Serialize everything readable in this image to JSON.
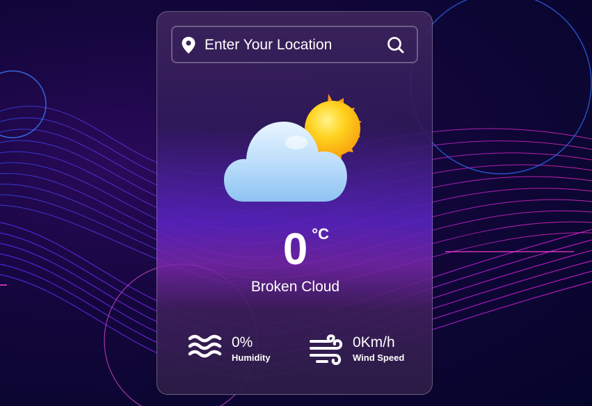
{
  "search": {
    "placeholder": "Enter Your Location",
    "location_icon": "map-pin-icon",
    "search_icon": "search-icon"
  },
  "weather": {
    "icon": "cloud-sun-icon",
    "temperature": "0",
    "unit": "°C",
    "description": "Broken Cloud"
  },
  "stats": {
    "humidity": {
      "icon": "waves-icon",
      "value": "0%",
      "label": "Humidity"
    },
    "wind": {
      "icon": "wind-icon",
      "value": "0Km/h",
      "label": "Wind Speed"
    }
  },
  "colors": {
    "accent_magenta": "#e21fd6",
    "accent_blue": "#3a4bff",
    "text": "#ffffff"
  }
}
